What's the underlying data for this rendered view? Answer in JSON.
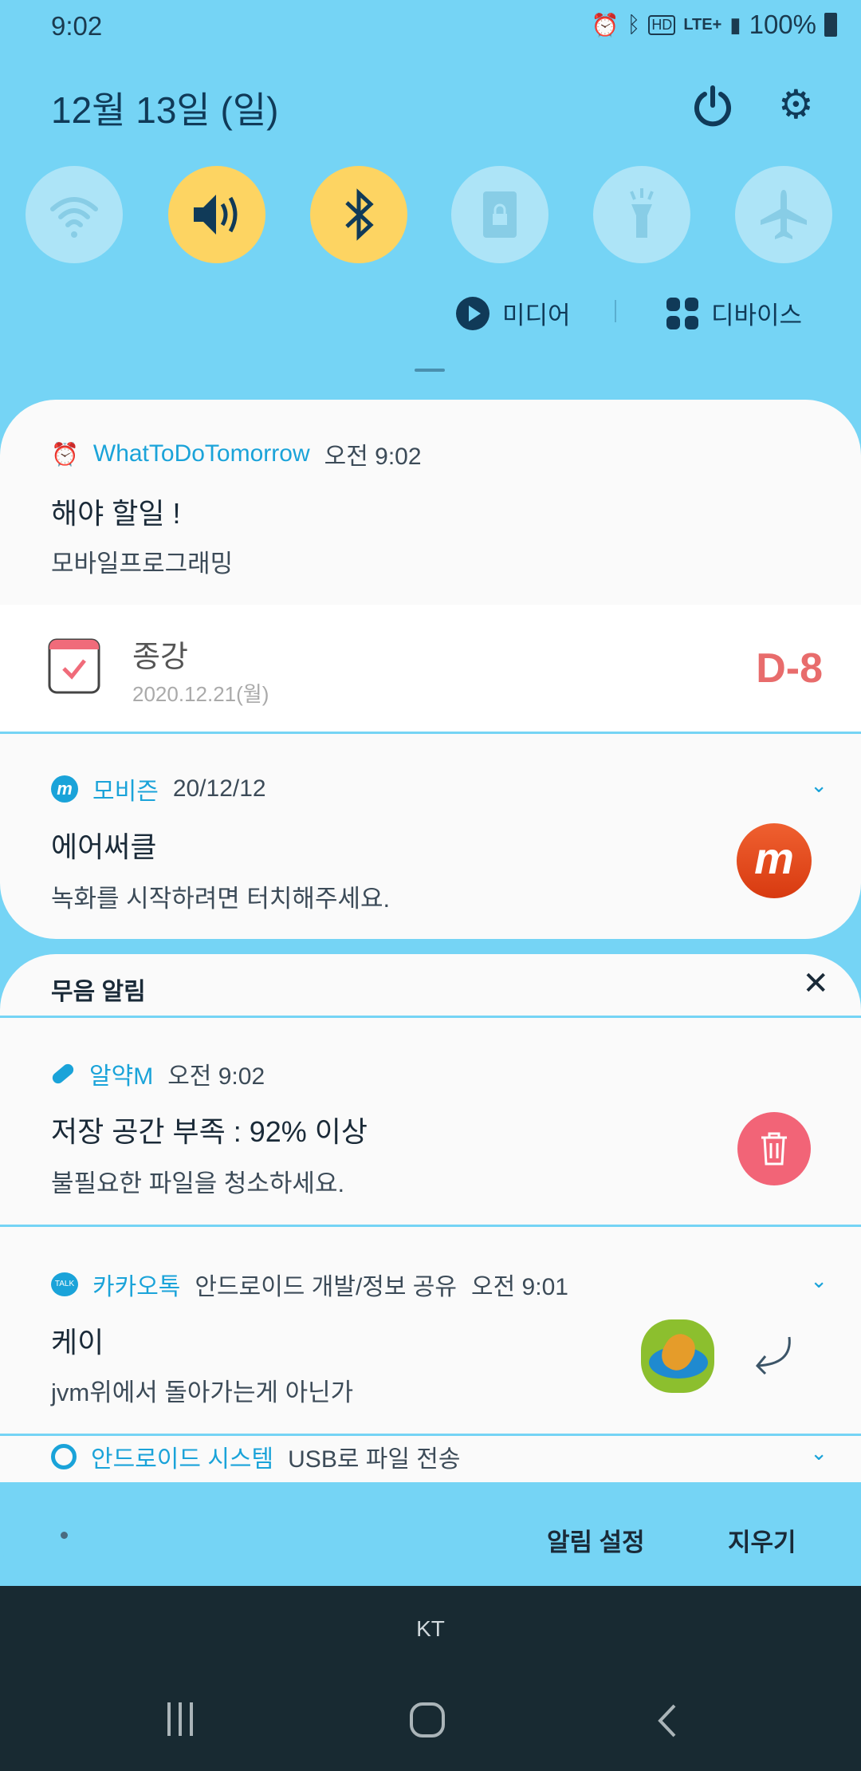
{
  "status_bar": {
    "time": "9:02",
    "battery": "100%",
    "network": "LTE+",
    "icons": [
      "alarm-icon",
      "bluetooth-icon",
      "hd-voice-icon",
      "lte-icon",
      "signal-icon",
      "battery-icon"
    ]
  },
  "header": {
    "date": "12월 13일 (일)"
  },
  "toggles": [
    {
      "name": "wifi",
      "on": false
    },
    {
      "name": "sound",
      "on": true
    },
    {
      "name": "bluetooth",
      "on": true
    },
    {
      "name": "screen-lock",
      "on": false
    },
    {
      "name": "flashlight",
      "on": false
    },
    {
      "name": "airplane",
      "on": false
    }
  ],
  "media": {
    "media_label": "미디어",
    "devices_label": "디바이스"
  },
  "notifications": {
    "todo": {
      "app": "WhatToDoTomorrow",
      "time": "오전 9:02",
      "title": "해야 할일 !",
      "text": "모바일프로그래밍"
    },
    "dday": {
      "title": "종강",
      "date": "2020.12.21(월)",
      "dday": "D-8"
    },
    "mobizen": {
      "app": "모비즌",
      "time": "20/12/12",
      "title": "에어써클",
      "text": "녹화를 시작하려면 터치해주세요."
    },
    "silent_header": "무음 알림",
    "alyak": {
      "app": "알약M",
      "time": "오전 9:02",
      "title": "저장 공간 부족 : 92% 이상",
      "text": "불필요한 파일을 청소하세요."
    },
    "kakao": {
      "app": "카카오톡",
      "channel": "안드로이드 개발/정보 공유",
      "time": "오전 9:01",
      "title": "케이",
      "text": "jvm위에서 돌아가는게 아닌가",
      "badge": "TALK"
    },
    "system": {
      "app": "안드로이드 시스템",
      "text": "USB로 파일 전송"
    }
  },
  "footer": {
    "settings": "알림 설정",
    "clear": "지우기"
  },
  "carrier": "KT",
  "colors": {
    "background": "#75d4f5",
    "toggle_on": "#fdd462",
    "accent": "#1aa3d9",
    "dday": "#e86c6c",
    "navbar": "#182a32"
  }
}
